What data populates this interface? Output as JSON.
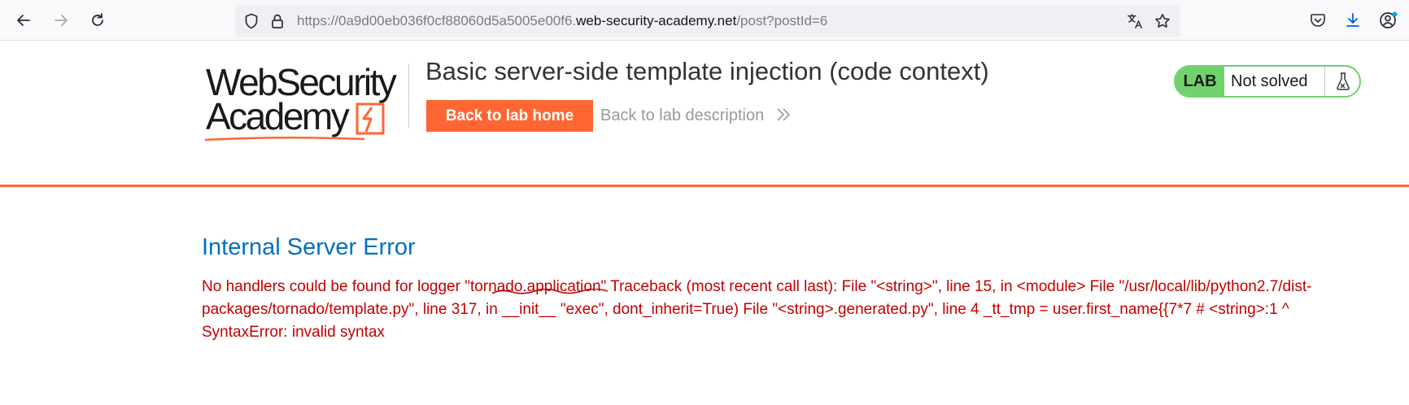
{
  "browser": {
    "url_prefix": "https://0a9d00eb036f0cf88060d5a5005e00f6.",
    "url_domain": "web-security-academy.net",
    "url_path": "/post?postId=6"
  },
  "header": {
    "logo_line1": "WebSecurity",
    "logo_line2": "Academy",
    "lab_title": "Basic server-side template injection (code context)",
    "back_home_label": "Back to lab home",
    "back_desc_label": "Back to lab description",
    "status_lab": "LAB",
    "status_text": "Not solved"
  },
  "content": {
    "error_title": "Internal Server Error",
    "error_message": " No handlers could be found for logger \"tornado.application\" Traceback (most recent call last): File \"<string>\", line 15, in <module> File \"/usr/local/lib/python2.7/dist-packages/tornado/template.py\", line 317, in __init__ \"exec\", dont_inherit=True) File \"<string>.generated.py\", line 4 _tt_tmp = user.first_name{{7*7 # <string>:1 ^ SyntaxError: invalid syntax"
  },
  "colors": {
    "accent": "#ff6633",
    "lab_green": "#70d16d",
    "error_red": "#c20000",
    "title_blue": "#0071bc"
  },
  "icons": [
    "back-arrow-icon",
    "forward-arrow-icon",
    "reload-icon",
    "shield-icon",
    "lock-icon",
    "translate-icon",
    "bookmark-star-icon",
    "pocket-icon",
    "download-icon",
    "account-icon",
    "flask-icon",
    "double-chevron-icon"
  ]
}
